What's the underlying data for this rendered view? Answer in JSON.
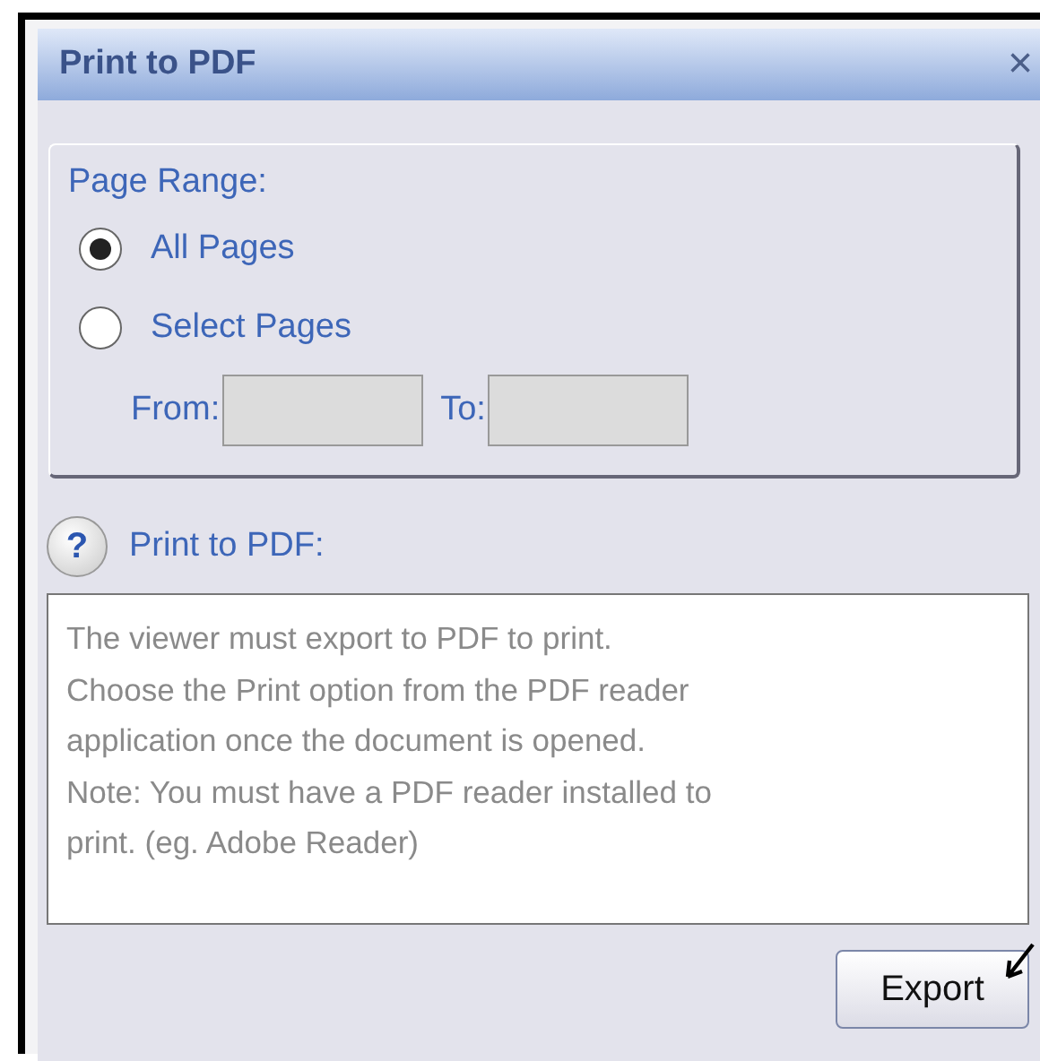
{
  "window": {
    "title": "Print to PDF",
    "close": "×"
  },
  "page_range": {
    "legend": "Page Range:",
    "options": [
      {
        "label": "All Pages",
        "selected": true
      },
      {
        "label": "Select Pages",
        "selected": false
      }
    ],
    "from": {
      "label": "From:",
      "disabled": true
    },
    "to": {
      "label": "To:",
      "disabled": true
    }
  },
  "help": {
    "icon": "?",
    "title": "Print to PDF:",
    "text": "The viewer must export to PDF to print.\nChoose the Print option from the PDF reader\napplication once the document is opened.\nNote: You must have a PDF reader installed to\nprint. (eg. Adobe Reader)"
  },
  "buttons": [
    "Export"
  ]
}
